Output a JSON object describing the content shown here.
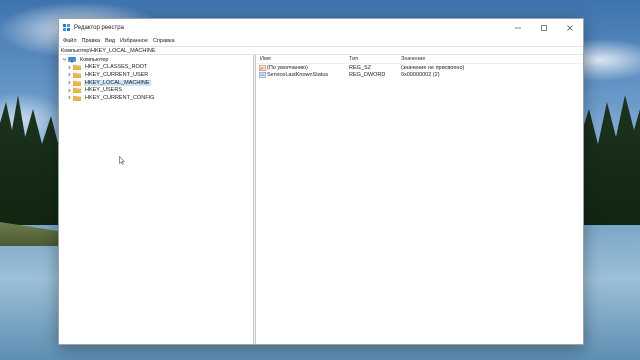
{
  "window": {
    "title": "Редактор реестра",
    "buttons": {
      "minimize": "minimize-icon",
      "maximize": "maximize-icon",
      "close": "close-icon"
    }
  },
  "menu": {
    "items": [
      "Файл",
      "Правка",
      "Вид",
      "Избранное",
      "Справка"
    ]
  },
  "address": {
    "path": "Компьютер\\HKEY_LOCAL_MACHINE"
  },
  "tree": {
    "root": {
      "label": "Компьютер",
      "icon": "computer-icon"
    },
    "items": [
      {
        "label": "HKEY_CLASSES_ROOT",
        "icon": "folder-icon"
      },
      {
        "label": "HKEY_CURRENT_USER",
        "icon": "folder-icon"
      },
      {
        "label": "HKEY_LOCAL_MACHINE",
        "icon": "folder-icon",
        "selected": true
      },
      {
        "label": "HKEY_USERS",
        "icon": "folder-icon"
      },
      {
        "label": "HKEY_CURRENT_CONFIG",
        "icon": "folder-icon"
      }
    ]
  },
  "list": {
    "columns": [
      "Имя",
      "Тип",
      "Значение"
    ],
    "rows": [
      {
        "name": "(По умолчанию)",
        "type": "REG_SZ",
        "data": "(значение не присвоено)",
        "icon": "string-value-icon"
      },
      {
        "name": "ServiceLastKnownStatus",
        "type": "REG_DWORD",
        "data": "0x00000002 (2)",
        "icon": "binary-value-icon"
      }
    ]
  },
  "colors": {
    "selection": "#cce4f7",
    "folder": "#e8b84a",
    "accent": "#0a64c8"
  }
}
